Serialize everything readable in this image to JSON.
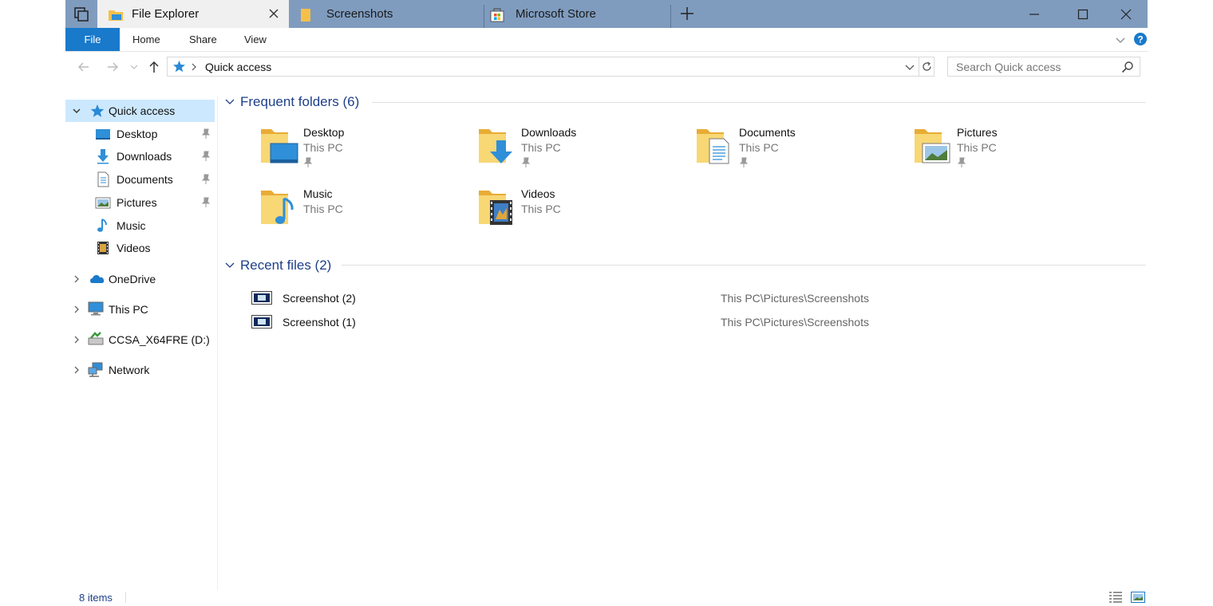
{
  "tabs": [
    {
      "label": "File Explorer",
      "active": true,
      "icon": "file-explorer-icon"
    },
    {
      "label": "Screenshots",
      "active": false,
      "icon": "folder-icon"
    },
    {
      "label": "Microsoft Store",
      "active": false,
      "icon": "store-icon"
    }
  ],
  "ribbon": {
    "file": "File",
    "home": "Home",
    "share": "Share",
    "view": "View"
  },
  "address": {
    "breadcrumb": "Quick access",
    "search_placeholder": "Search Quick access"
  },
  "nav": {
    "quick_access": "Quick access",
    "pinned": [
      {
        "label": "Desktop",
        "icon": "desktop-icon",
        "pinned": true
      },
      {
        "label": "Downloads",
        "icon": "downloads-icon",
        "pinned": true
      },
      {
        "label": "Documents",
        "icon": "documents-icon",
        "pinned": true
      },
      {
        "label": "Pictures",
        "icon": "pictures-icon",
        "pinned": true
      },
      {
        "label": "Music",
        "icon": "music-icon",
        "pinned": false
      },
      {
        "label": "Videos",
        "icon": "videos-icon",
        "pinned": false
      }
    ],
    "roots": [
      {
        "label": "OneDrive",
        "icon": "onedrive-icon"
      },
      {
        "label": "This PC",
        "icon": "this-pc-icon"
      },
      {
        "label": "CCSA_X64FRE (D:)",
        "icon": "dvd-drive-icon"
      },
      {
        "label": "Network",
        "icon": "network-icon"
      }
    ]
  },
  "frequent": {
    "title": "Frequent folders (6)",
    "folders": [
      {
        "name": "Desktop",
        "location": "This PC",
        "pinned": true
      },
      {
        "name": "Downloads",
        "location": "This PC",
        "pinned": true
      },
      {
        "name": "Documents",
        "location": "This PC",
        "pinned": true
      },
      {
        "name": "Pictures",
        "location": "This PC",
        "pinned": true
      },
      {
        "name": "Music",
        "location": "This PC",
        "pinned": false
      },
      {
        "name": "Videos",
        "location": "This PC",
        "pinned": false
      }
    ]
  },
  "recent": {
    "title": "Recent files (2)",
    "files": [
      {
        "name": "Screenshot (2)",
        "path": "This PC\\Pictures\\Screenshots"
      },
      {
        "name": "Screenshot (1)",
        "path": "This PC\\Pictures\\Screenshots"
      }
    ]
  },
  "status": {
    "items": "8 items"
  },
  "colors": {
    "titlebar": "#7f9cbf",
    "file_tab": "#1979ca",
    "selection": "#cce8ff",
    "group_title": "#1e3f8a",
    "folder": "#f5c04a"
  }
}
